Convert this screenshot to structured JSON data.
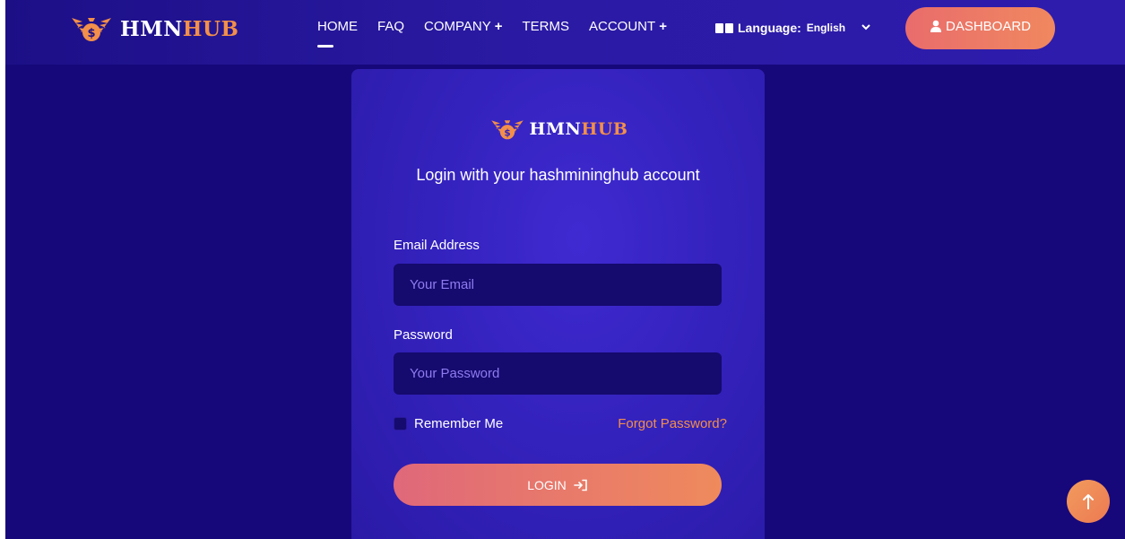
{
  "brand": {
    "name_part1": "HMN",
    "name_part2": "HUB",
    "logo_icon": "winged-money-bag-icon"
  },
  "nav": {
    "items": [
      {
        "label": "HOME",
        "has_plus": false
      },
      {
        "label": "FAQ",
        "has_plus": false
      },
      {
        "label": "COMPANY",
        "has_plus": true
      },
      {
        "label": "TERMS",
        "has_plus": false
      },
      {
        "label": "ACCOUNT",
        "has_plus": true
      }
    ],
    "plus_symbol": "+",
    "language": {
      "label": "Language:",
      "value": "English",
      "chevron": "⌄"
    },
    "dashboard_label": "DASHBOARD"
  },
  "login": {
    "subtitle": "Login with your hashmininghub account",
    "email_label": "Email Address",
    "email_placeholder": "Your Email",
    "email_value": "",
    "password_label": "Password",
    "password_placeholder": "Your Password",
    "password_value": "",
    "remember_label": "Remember Me",
    "remember_checked": false,
    "forgot_label": "Forgot Password?",
    "submit_label": "LOGIN"
  },
  "colors": {
    "background": "#16087a",
    "accent": "#f28f4a",
    "button_gradient_start": "#e96c6c",
    "button_gradient_end": "#f0885f",
    "input_background": "#150a6e",
    "placeholder": "#8e7cf0"
  }
}
